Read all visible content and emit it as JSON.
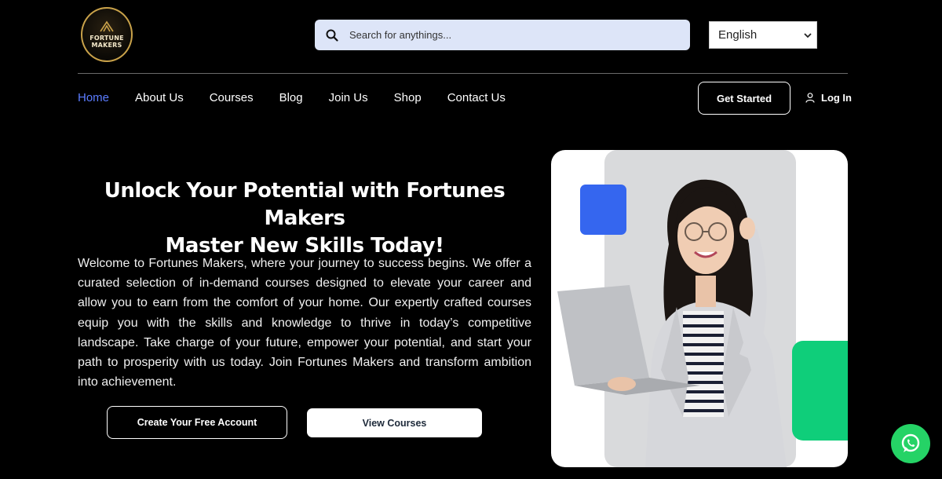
{
  "brand": {
    "logo_line1": "FORTUNE",
    "logo_line2": "MAKERS",
    "gold": "#c9a24a"
  },
  "search": {
    "placeholder": "Search for anythings...",
    "icon": "search-icon"
  },
  "language": {
    "selected": "English"
  },
  "nav": {
    "items": [
      {
        "label": "Home",
        "active": true
      },
      {
        "label": "About Us"
      },
      {
        "label": "Courses"
      },
      {
        "label": "Blog"
      },
      {
        "label": "Join Us"
      },
      {
        "label": "Shop"
      },
      {
        "label": "Contact Us"
      }
    ],
    "active_color": "#5b7cff",
    "get_started": "Get Started",
    "login": "Log In"
  },
  "hero": {
    "title_line1": "Unlock Your Potential with Fortunes Makers",
    "title_line2": "Master New Skills Today!",
    "body": "Welcome to Fortunes Makers, where your journey to success begins. We offer a curated selection of in-demand courses designed to elevate your career and allow you to earn from the comfort of your home. Our expertly crafted courses equip you with the skills and knowledge to thrive in today’s competitive landscape. Take charge of your future, empower your potential, and start your path to prosperity with us today. Join Fortunes Makers and transform ambition into achievement.",
    "cta_primary": "Create Your Free Account",
    "cta_secondary": "View Courses"
  },
  "colors": {
    "accent_blue": "#3566ef",
    "accent_green": "#0fce7a",
    "whatsapp": "#25d366"
  },
  "floating": {
    "icon": "whatsapp-icon"
  }
}
